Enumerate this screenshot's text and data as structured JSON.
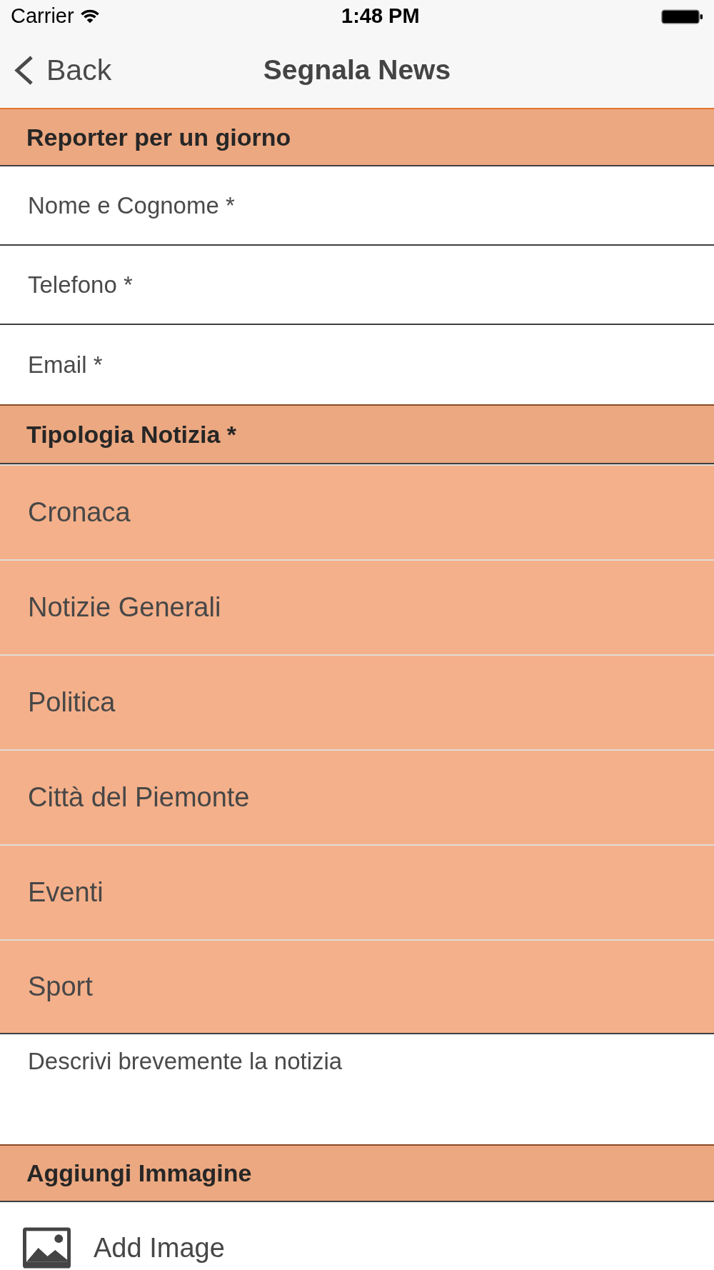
{
  "status_bar": {
    "carrier": "Carrier",
    "time": "1:48 PM"
  },
  "nav_bar": {
    "back_label": "Back",
    "title": "Segnala News"
  },
  "contact_section": {
    "title": "Reporter per un giorno",
    "fields": [
      {
        "placeholder": "Nome e Cognome *"
      },
      {
        "placeholder": "Telefono *"
      },
      {
        "placeholder": "Email *"
      }
    ]
  },
  "news_type_section": {
    "title": "Tipologia Notizia *",
    "options": [
      {
        "label": "Cronaca",
        "selected": false
      },
      {
        "label": "Notizie Generali",
        "selected": false
      },
      {
        "label": "Politica",
        "selected": false
      },
      {
        "label": "Città del Piemonte",
        "selected": false
      },
      {
        "label": "Eventi",
        "selected": false
      },
      {
        "label": "Sport",
        "selected": false
      }
    ]
  },
  "description": {
    "placeholder": "Descrivi brevemente la notizia"
  },
  "image_section": {
    "title": "Aggiungi Immagine",
    "button_label": "Add Image"
  }
}
